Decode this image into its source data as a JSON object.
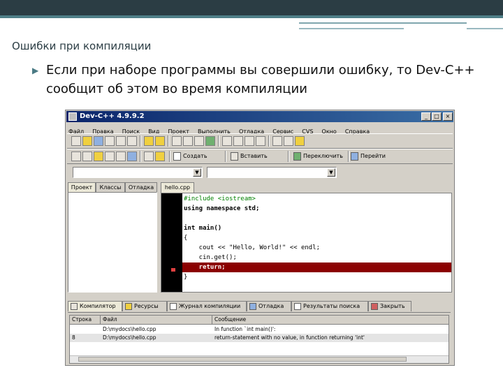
{
  "slide": {
    "title": "Ошибки при компиляции",
    "bullet_line1": "Если при наборе программы вы совершили ошибку, то Dev-C++",
    "bullet_line2": "сообщит об этом во время компиляции"
  },
  "window": {
    "title": "Dev-C++ 4.9.9.2",
    "min_label": "_",
    "max_label": "□",
    "close_label": "×"
  },
  "menu": [
    "Файл",
    "Правка",
    "Поиск",
    "Вид",
    "Проект",
    "Выполнить",
    "Отладка",
    "Сервис",
    "CVS",
    "Окно",
    "Справка"
  ],
  "toolbar2": {
    "create": "Создать",
    "insert": "Вставить",
    "toggle": "Переключить",
    "goto": "Перейти"
  },
  "left_tabs": [
    "Проект",
    "Классы",
    "Отладка"
  ],
  "editor": {
    "tab": "hello.cpp",
    "lines": [
      "#include <iostream>",
      "using namespace std;",
      "",
      "int main()",
      "{",
      "    cout << \"Hello, World!\" << endl;",
      "    cin.get();",
      "    return;",
      "}"
    ],
    "error_line": 7
  },
  "bottom_tabs": [
    "Компилятор",
    "Ресурсы",
    "Журнал компиляции",
    "Отладка",
    "Результаты поиска",
    "Закрыть"
  ],
  "messages": {
    "headers": [
      "Строка",
      "Файл",
      "Сообщение"
    ],
    "rows": [
      [
        "",
        "D:\\mydocs\\hello.cpp",
        "In function `int main()':"
      ],
      [
        "8",
        "D:\\mydocs\\hello.cpp",
        "return-statement with no value, in function returning 'int'"
      ]
    ]
  }
}
